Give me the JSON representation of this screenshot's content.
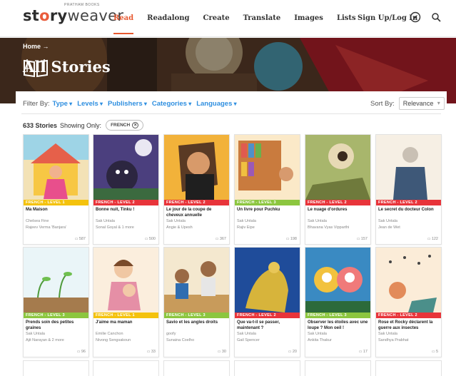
{
  "brand": {
    "story": "st",
    "o": "o",
    "ry": "ry",
    "weaver": "weaver",
    "sub": "PRATHAM BOOKS"
  },
  "nav": {
    "items": [
      "Read",
      "Readalong",
      "Create",
      "Translate",
      "Images",
      "Lists"
    ],
    "active": "Read",
    "signup": "Sign Up/Log In"
  },
  "hero": {
    "breadcrumb": "Home →",
    "title": "All Stories"
  },
  "filters": {
    "label": "Filter By:",
    "items": [
      "Type",
      "Levels",
      "Publishers",
      "Categories",
      "Languages"
    ]
  },
  "sort": {
    "label": "Sort By:",
    "value": "Relevance"
  },
  "results": {
    "count": "633 Stories",
    "showing": "Showing Only:",
    "chip": "FRENCH"
  },
  "colors": {
    "level1": "#f4c20d",
    "level2": "#e8343a",
    "level3": "#8cc63f",
    "accent": "#e7582f",
    "link": "#2f8fe0"
  },
  "cards": [
    {
      "level": "FRENCH - LEVEL 1",
      "title": "Ma Maison",
      "author": "Chelsea Fine",
      "illustrator": "Rajeev Verma 'Banjara'",
      "reads": "587"
    },
    {
      "level": "FRENCH - LEVEL 2",
      "title": "Bonne nuit, Tinku !",
      "author": "Sak Untala",
      "illustrator": "Sonal Goyal & 1 more",
      "reads": "500"
    },
    {
      "level": "FRENCH - LEVEL 2",
      "title": "Le jour de la coupe de cheveux annuelle",
      "author": "Sak Untala",
      "illustrator": "Angie & Upesh",
      "reads": "367"
    },
    {
      "level": "FRENCH - LEVEL 3",
      "title": "Un livre pour Puchku",
      "author": "Sak Untala",
      "illustrator": "Rajiv Eipe",
      "reads": "198"
    },
    {
      "level": "FRENCH - LEVEL 2",
      "title": "Le nuage d'ordures",
      "author": "Sak Untala",
      "illustrator": "Bhavana Vyas Vipparthi",
      "reads": "157"
    },
    {
      "level": "FRENCH - LEVEL 2",
      "title": "Le secret du docteur Colon",
      "author": "Sak Untala",
      "illustrator": "Jean de Wet",
      "reads": "122"
    },
    {
      "level": "FRENCH - LEVEL 3",
      "title": "Prends soin des petites graines",
      "author": "Sak Untala",
      "illustrator": "Ajit Narayan & 2 more",
      "reads": "96"
    },
    {
      "level": "FRENCH - LEVEL 1",
      "title": "J'aime ma maman",
      "author": "Emilie Canchon",
      "illustrator": "Nivong Sengsakoun",
      "reads": "33"
    },
    {
      "level": "FRENCH - LEVEL 3",
      "title": "Savio et les angles droits",
      "author": "goofy",
      "illustrator": "Sunaina Coelho",
      "reads": "30"
    },
    {
      "level": "FRENCH - LEVEL 2",
      "title": "Que va-t-il se passer, maintenant ?",
      "author": "Sak Untala",
      "illustrator": "Gail Spencer",
      "reads": "20"
    },
    {
      "level": "FRENCH - LEVEL 3",
      "title": "Observer les étoiles avec une loupe ? Mon oeil !",
      "author": "Sak Untala",
      "illustrator": "Ankita Thakur",
      "reads": "17"
    },
    {
      "level": "FRENCH - LEVEL 2",
      "title": "Rose et Rocky déclarent la guerre aux insectes",
      "author": "Sak Untala",
      "illustrator": "Sandhya Prabhat",
      "reads": "5"
    }
  ]
}
